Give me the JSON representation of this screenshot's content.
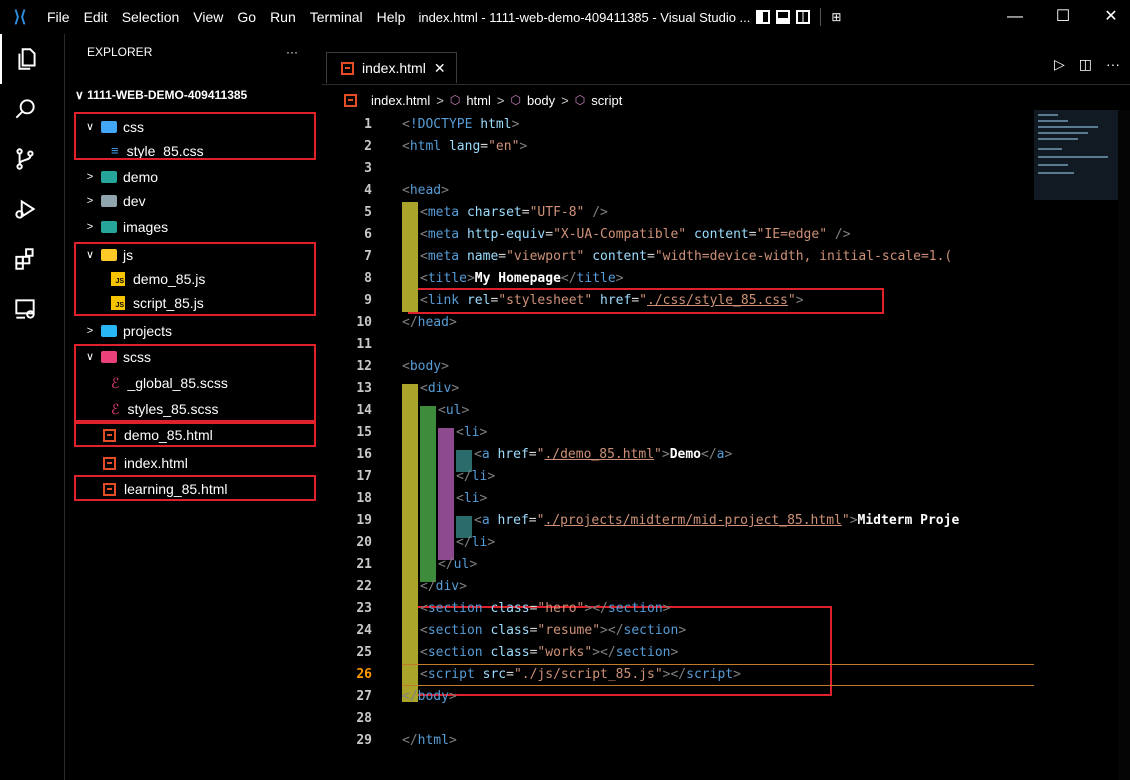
{
  "titlebar": {
    "menu": [
      "File",
      "Edit",
      "Selection",
      "View",
      "Go",
      "Run",
      "Terminal",
      "Help"
    ],
    "title": "index.html - 1111-web-demo-409411385 - Visual Studio ...",
    "minimize": "—",
    "maximize": "☐",
    "close": "✕"
  },
  "sidebar": {
    "header": "EXPLORER",
    "more": "···",
    "root": "1111-WEB-DEMO-409411385",
    "items": [
      {
        "label": "css",
        "chev": "∨",
        "icon": "folder-css"
      },
      {
        "label": "style_85.css",
        "icon": "css-file-icon"
      },
      {
        "label": "demo",
        "chev": ">",
        "icon": "folder-demo"
      },
      {
        "label": "dev",
        "chev": ">",
        "icon": "folder-dev"
      },
      {
        "label": "images",
        "chev": ">",
        "icon": "folder-images"
      },
      {
        "label": "js",
        "chev": "∨",
        "icon": "folder-js"
      },
      {
        "label": "demo_85.js",
        "icon": "js-file-icon"
      },
      {
        "label": "script_85.js",
        "icon": "js-file-icon"
      },
      {
        "label": "projects",
        "chev": ">",
        "icon": "folder-projects"
      },
      {
        "label": "scss",
        "chev": "∨",
        "icon": "folder-scss"
      },
      {
        "label": "_global_85.scss",
        "icon": "scss-file-icon"
      },
      {
        "label": "styles_85.scss",
        "icon": "scss-file-icon"
      },
      {
        "label": "demo_85.html",
        "icon": "html-file-icon"
      },
      {
        "label": "index.html",
        "icon": "html-file-icon"
      },
      {
        "label": "learning_85.html",
        "icon": "html-file-icon"
      }
    ]
  },
  "editor": {
    "tab": "index.html",
    "tab_close": "✕",
    "breadcrumb": [
      "index.html",
      "html",
      "body",
      "script"
    ],
    "active_line": 26
  },
  "code": [
    {
      "n": "1"
    },
    {
      "n": "2"
    },
    {
      "n": "3"
    },
    {
      "n": "4"
    },
    {
      "n": "5"
    },
    {
      "n": "6"
    },
    {
      "n": "7"
    },
    {
      "n": "8"
    },
    {
      "n": "9"
    },
    {
      "n": "10"
    },
    {
      "n": "11"
    },
    {
      "n": "12"
    },
    {
      "n": "13"
    },
    {
      "n": "14"
    },
    {
      "n": "15"
    },
    {
      "n": "16"
    },
    {
      "n": "17"
    },
    {
      "n": "18"
    },
    {
      "n": "19"
    },
    {
      "n": "20"
    },
    {
      "n": "21"
    },
    {
      "n": "22"
    },
    {
      "n": "23"
    },
    {
      "n": "24"
    },
    {
      "n": "25"
    },
    {
      "n": "26"
    },
    {
      "n": "27"
    },
    {
      "n": "28"
    },
    {
      "n": "29"
    }
  ],
  "colors": {
    "highlight_box": "#e0202a",
    "tag": "#569cd6",
    "attribute": "#9cdcfe",
    "string": "#ce9178"
  }
}
